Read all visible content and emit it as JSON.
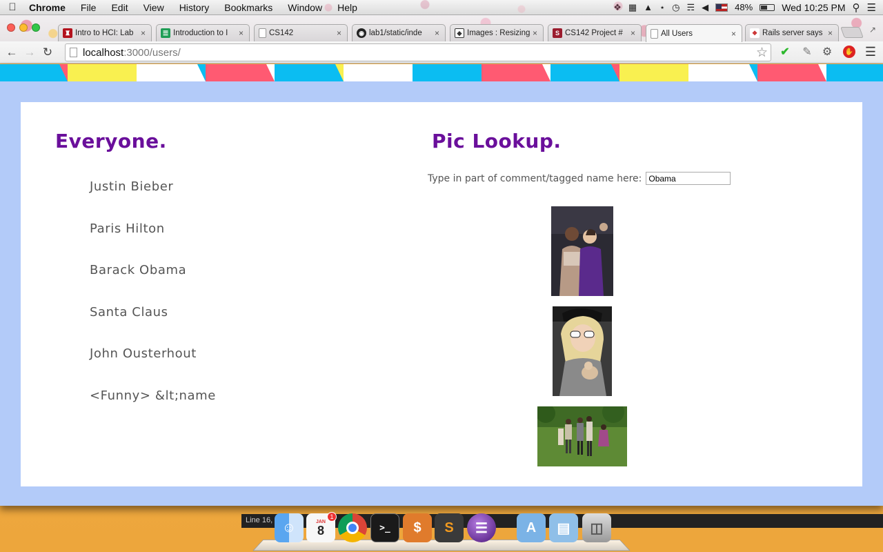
{
  "menubar": {
    "app_name": "Chrome",
    "items": [
      "File",
      "Edit",
      "View",
      "History",
      "Bookmarks",
      "Window",
      "Help"
    ],
    "battery": "48%",
    "clock": "Wed 10:25 PM"
  },
  "tabs": [
    {
      "label": "Intro to HCI: Lab",
      "icon": "red-logo-icon",
      "color": "#b3121d"
    },
    {
      "label": "Introduction to I",
      "icon": "sheets-icon",
      "color": "#1f9d55"
    },
    {
      "label": "CS142",
      "icon": "page-icon",
      "color": "#ffffff"
    },
    {
      "label": "lab1/static/inde",
      "icon": "github-icon",
      "color": "#222222"
    },
    {
      "label": "Images : Resizing",
      "icon": "tag-icon",
      "color": "#333333"
    },
    {
      "label": "CS142 Project #",
      "icon": "stanford-icon",
      "color": "#9b1c2e"
    },
    {
      "label": "All Users",
      "icon": "page-icon",
      "color": "#ffffff",
      "active": true
    },
    {
      "label": "Rails server says",
      "icon": "rails-icon",
      "color": "#cc3333"
    }
  ],
  "toolbar": {
    "url_host": "localhost",
    "url_path": ":3000/users/"
  },
  "page": {
    "left_title": "Everyone.",
    "right_title": "Pic Lookup.",
    "lookup_label": "Type in part of comment/tagged name here:",
    "lookup_value": "Obama",
    "users": [
      "Justin Bieber",
      "Paris Hilton",
      "Barack Obama",
      "Santa Claus",
      "John Ousterhout",
      "<Funny> &lt;name"
    ]
  },
  "dock": {
    "status_text": "Line 16,",
    "calendar_month": "JAN",
    "calendar_day": "8",
    "calendar_badge": "1"
  },
  "colors": {
    "title_purple": "#6a0f9b",
    "page_bg": "#b3cbf9",
    "bunting": [
      "#f9f050",
      "#ff5a72",
      "#0bbdf2",
      "#ffffff"
    ]
  }
}
